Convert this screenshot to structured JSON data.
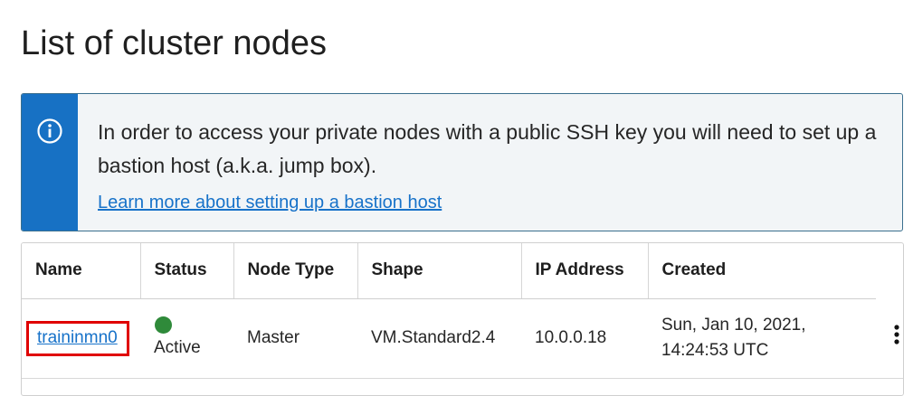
{
  "page": {
    "title": "List of cluster nodes"
  },
  "notice": {
    "icon": "info-icon",
    "accent_color": "#1771c4",
    "text": "In order to access your private nodes with a public SSH key you will need to set up a bastion host (a.k.a. jump box).",
    "link": "Learn more about setting up a bastion host"
  },
  "table": {
    "columns": [
      "Name",
      "Status",
      "Node Type",
      "Shape",
      "IP Address",
      "Created"
    ],
    "rows": [
      {
        "name": "traininmn0",
        "status": "Active",
        "status_color": "#2f8a3a",
        "node_type": "Master",
        "shape": "VM.Standard2.4",
        "ip_address": "10.0.0.18",
        "created_line1": "Sun, Jan 10, 2021,",
        "created_line2": "14:24:53 UTC",
        "actions_icon": "kebab-menu-icon"
      }
    ]
  }
}
